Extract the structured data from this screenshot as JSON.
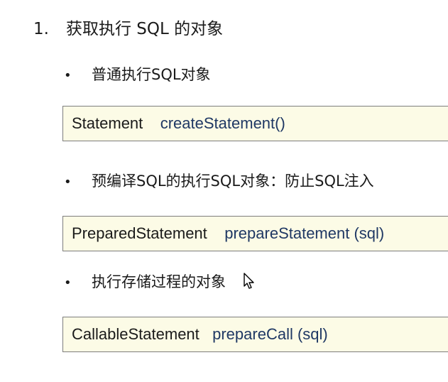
{
  "heading": {
    "number": "1.",
    "text": "获取执行 SQL 的对象"
  },
  "sections": [
    {
      "bullet": "•",
      "label": "普通执行SQL对象",
      "class_name": "Statement",
      "method": "createStatement()"
    },
    {
      "bullet": "•",
      "label": "预编译SQL的执行SQL对象：防止SQL注入",
      "class_name": "PreparedStatement",
      "method": "prepareStatement (sql)"
    },
    {
      "bullet": "•",
      "label": "执行存储过程的对象",
      "class_name": "CallableStatement",
      "method": "prepareCall (sql)"
    }
  ],
  "colors": {
    "box_background": "#fcfbe6",
    "box_border": "#7d7d7d",
    "method_text": "#1f3864"
  },
  "icons": {
    "cursor": "mouse-pointer-icon"
  }
}
